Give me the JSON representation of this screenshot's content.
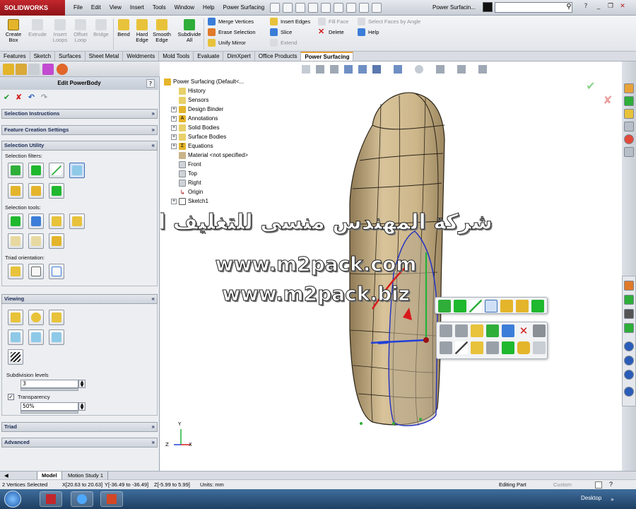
{
  "app": {
    "name": "SOLIDWORKS",
    "doc_title": "Power Surfacin..."
  },
  "menu": [
    "File",
    "Edit",
    "View",
    "Insert",
    "Tools",
    "Window",
    "Help",
    "Power Surfacing"
  ],
  "commands": {
    "create_box": "Create Box",
    "extrude": "Extrude",
    "insert_loops": "Insert Loops",
    "offset_loop": "Offset Loop",
    "bridge": "Bridge",
    "bend": "Bend",
    "hard_edge": "Hard Edge",
    "smooth_edge": "Smooth Edge",
    "subdivide_all": "Subdivide All",
    "merge_vertices": "Merge Vertices",
    "erase_selection": "Erase Selection",
    "unify_mirror": "Unify Mirror",
    "insert_edges": "Insert Edges",
    "slice": "Slice",
    "extend": "Extend",
    "fill_face": "Fill Face",
    "delete": "Delete",
    "select_faces_by_angle": "Select Faces by Angle",
    "help": "Help"
  },
  "tabs": [
    "Features",
    "Sketch",
    "Surfaces",
    "Sheet Metal",
    "Weldments",
    "Mold Tools",
    "Evaluate",
    "DimXpert",
    "Office Products",
    "Power Surfacing"
  ],
  "panel": {
    "title": "Edit PowerBody",
    "help": "?",
    "sections": {
      "selection_instructions": "Selection Instructions",
      "feature_creation": "Feature Creation Settings",
      "selection_utility": "Selection Utility",
      "viewing": "Viewing",
      "triad": "Triad",
      "advanced": "Advanced"
    },
    "selection_filters": "Selection filters:",
    "selection_tools": "Selection tools:",
    "triad_orientation": "Triad orientation:",
    "subdivision_label": "Subdivision levels",
    "subdivision_value": "3",
    "transparency_label": "Transparency",
    "transparency_value": "50%",
    "transparency_checked": true
  },
  "tree": {
    "root": "Power Surfacing  (Default<...",
    "items": [
      "History",
      "Sensors",
      "Design Binder",
      "Annotations",
      "Solid Bodies",
      "Surface Bodies",
      "Equations",
      "Material <not specified>",
      "Front",
      "Top",
      "Right",
      "Origin",
      "Sketch1"
    ]
  },
  "watermark": {
    "arabic": "شركة المهندس منسى للتغليف الحديث",
    "url1": "www.m2pack.com",
    "url2": "www.m2pack.biz"
  },
  "triad": {
    "y": "Y",
    "z": "Z",
    "x": "X"
  },
  "bottom_tabs": [
    "Model",
    "Motion Study 1"
  ],
  "status": {
    "selected": "2 Vertices Selected",
    "x": "X[20.63 to 20.63]",
    "y": "Y[-36.49 to -36.49]",
    "z": "Z[-5.99 to 5.99]",
    "units": "Units: mm",
    "mode": "Editing Part",
    "custom": "Custom"
  },
  "taskbar": {
    "desktop": "Desktop"
  },
  "colors": {
    "accent": "#e8a23a",
    "brand": "#b31e24",
    "body": "#c8b48a"
  }
}
